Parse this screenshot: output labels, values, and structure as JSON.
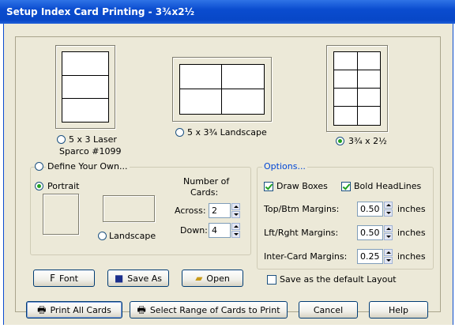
{
  "window": {
    "title": "Setup Index Card Printing - 3¾x2½"
  },
  "layouts": {
    "laser_label_line1": "5 x 3 Laser",
    "laser_label_line2": "Sparco #1099",
    "landscape_label": "5 x 3¾ Landscape",
    "small_label": "3¾ x 2½",
    "selected": "3¾ x 2½"
  },
  "define_own": {
    "label": "Define Your Own...",
    "portrait_label": "Portrait",
    "landscape_label": "Landscape",
    "orientation": "Portrait",
    "number_heading_line1": "Number of",
    "number_heading_line2": "Cards:",
    "across_label": "Across:",
    "across_value": "2",
    "down_label": "Down:",
    "down_value": "4"
  },
  "options": {
    "legend": "Options...",
    "draw_boxes_label": "Draw Boxes",
    "draw_boxes_checked": true,
    "bold_headlines_label": "Bold HeadLines",
    "bold_headlines_checked": true,
    "top_btm_label": "Top/Btm Margins:",
    "top_btm_value": "0.50",
    "lft_rght_label": "Lft/Rght Margins:",
    "lft_rght_value": "0.50",
    "inter_card_label": "Inter-Card Margins:",
    "inter_card_value": "0.25",
    "unit": "inches",
    "save_default_label": "Save as the default Layout",
    "save_default_checked": false
  },
  "toolbar": {
    "font_label": "Font",
    "save_as_label": "Save As",
    "open_label": "Open"
  },
  "footer": {
    "print_all_label": "Print All Cards",
    "select_range_label": "Select Range of Cards to Print",
    "cancel_label": "Cancel",
    "help_label": "Help"
  },
  "colors": {
    "title_bar": "#0a4ccf",
    "dialog_bg": "#ece9d8",
    "radio_dot": "#21a121"
  }
}
